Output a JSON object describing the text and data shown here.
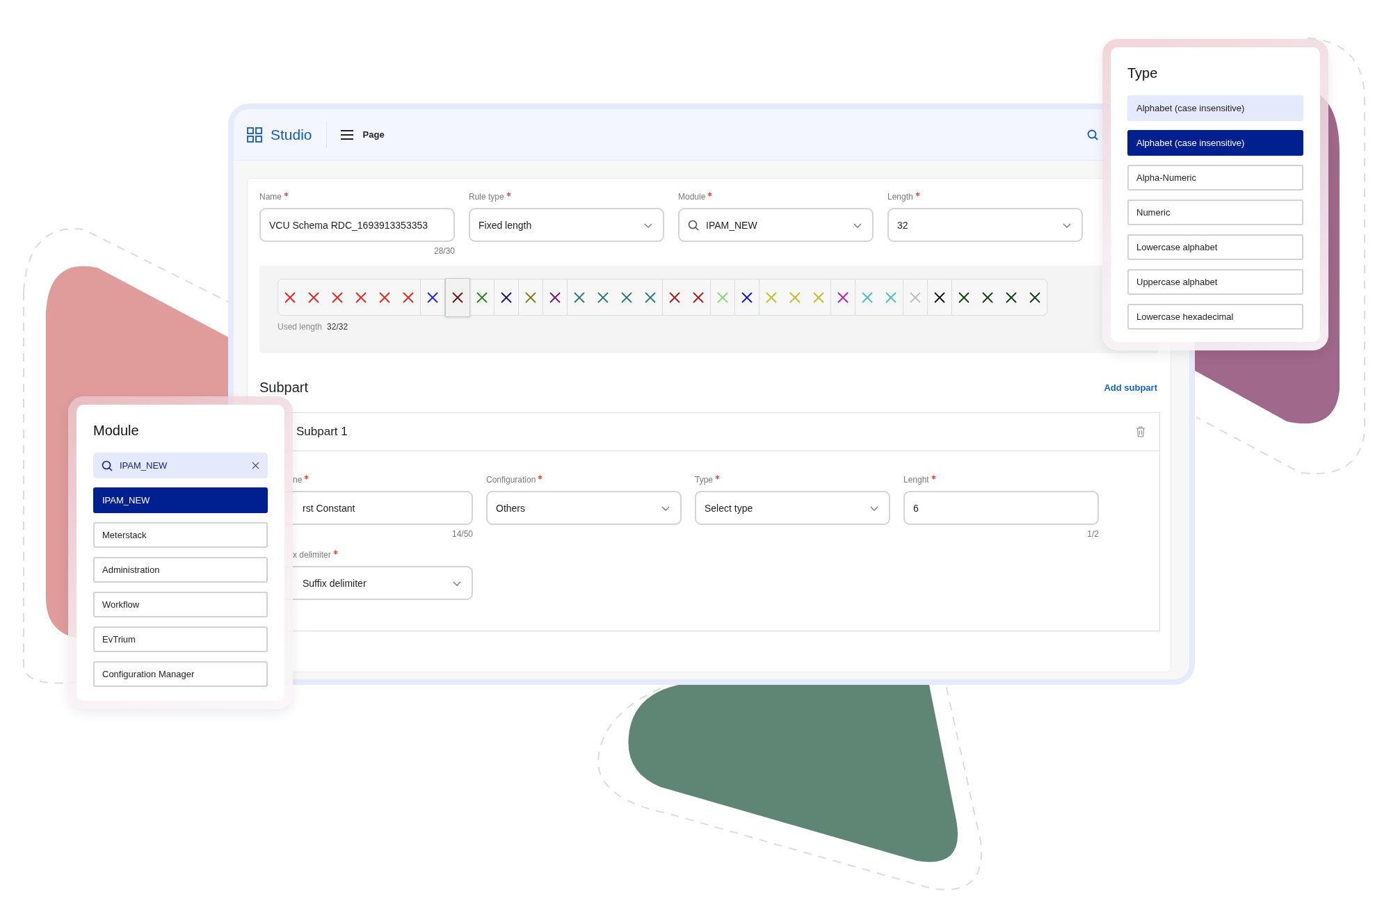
{
  "header": {
    "app_name": "Studio",
    "page_label": "Page"
  },
  "rule_fields": [
    {
      "label": "Name",
      "required": true,
      "kind": "text",
      "value": "VCU Schema RDC_1693913353353",
      "counter": "28/30"
    },
    {
      "label": "Rule type",
      "required": true,
      "kind": "select",
      "value": "Fixed length"
    },
    {
      "label": "Module",
      "required": true,
      "kind": "search-select",
      "value": "IPAM_NEW"
    },
    {
      "label": "Length",
      "required": true,
      "kind": "select",
      "value": "32"
    }
  ],
  "char_strip": {
    "used_label": "Used length",
    "used_value": "32/32",
    "groups": [
      {
        "selected": false,
        "marks": [
          {
            "color": "#e8231f"
          },
          {
            "color": "#e8231f"
          },
          {
            "color": "#e8231f"
          },
          {
            "color": "#e8231f"
          },
          {
            "color": "#e8231f"
          },
          {
            "color": "#e8231f"
          }
        ]
      },
      {
        "selected": false,
        "marks": [
          {
            "color": "#1f1fff"
          }
        ]
      },
      {
        "selected": true,
        "marks": [
          {
            "color": "#6b1010"
          }
        ]
      },
      {
        "selected": false,
        "marks": [
          {
            "color": "#2f7d1f"
          }
        ]
      },
      {
        "selected": false,
        "marks": [
          {
            "color": "#14147f"
          }
        ]
      },
      {
        "selected": false,
        "marks": [
          {
            "color": "#7b7b16"
          }
        ]
      },
      {
        "selected": false,
        "marks": [
          {
            "color": "#6c1b7b"
          }
        ]
      },
      {
        "selected": false,
        "marks": [
          {
            "color": "#2b7b78"
          },
          {
            "color": "#2b7b78"
          },
          {
            "color": "#2b7b78"
          },
          {
            "color": "#2b7b78"
          }
        ]
      },
      {
        "selected": false,
        "marks": [
          {
            "color": "#a81a1a"
          },
          {
            "color": "#a81a1a"
          }
        ]
      },
      {
        "selected": false,
        "marks": [
          {
            "color": "#8cd870"
          }
        ]
      },
      {
        "selected": false,
        "marks": [
          {
            "color": "#1515c0"
          }
        ]
      },
      {
        "selected": false,
        "marks": [
          {
            "color": "#bfbf25"
          },
          {
            "color": "#bfbf25"
          },
          {
            "color": "#bfbf25"
          }
        ]
      },
      {
        "selected": false,
        "marks": [
          {
            "color": "#b51cb5"
          }
        ]
      },
      {
        "selected": false,
        "marks": [
          {
            "color": "#4bbfbf"
          },
          {
            "color": "#4bbfbf"
          }
        ]
      },
      {
        "selected": false,
        "marks": [
          {
            "color": "#bdbdbd"
          }
        ]
      },
      {
        "selected": false,
        "marks": [
          {
            "color": "#111111"
          }
        ]
      },
      {
        "selected": false,
        "marks": [
          {
            "color": "#143a14"
          },
          {
            "color": "#143a14"
          },
          {
            "color": "#143a14"
          },
          {
            "color": "#143a14"
          }
        ]
      }
    ]
  },
  "subpart": {
    "title": "Subpart",
    "add_link": "Add subpart",
    "cards": [
      {
        "title": "Subpart 1",
        "rows": [
          [
            {
              "label": "ne",
              "required": true,
              "kind": "text",
              "value": "rst Constant",
              "counter": "14/50"
            },
            {
              "label": "Configuration",
              "required": true,
              "kind": "select",
              "value": "Others"
            },
            {
              "label": "Type",
              "required": true,
              "kind": "select",
              "value": "Select type"
            },
            {
              "label": "Lenght",
              "required": true,
              "kind": "text",
              "value": "6",
              "counter": "1/2"
            }
          ],
          [
            {
              "label": "x delimiter",
              "required": true,
              "kind": "select",
              "value": "Suffix delimiter"
            }
          ]
        ]
      }
    ]
  },
  "module_panel": {
    "title": "Module",
    "search": {
      "value": "IPAM_NEW"
    },
    "options": [
      {
        "label": "IPAM_NEW",
        "selected": true
      },
      {
        "label": "Meterstack",
        "selected": false
      },
      {
        "label": "Administration",
        "selected": false
      },
      {
        "label": "Workflow",
        "selected": false
      },
      {
        "label": "EvTrium",
        "selected": false
      },
      {
        "label": "Configuration Manager",
        "selected": false
      }
    ]
  },
  "type_panel": {
    "title": "Type",
    "options": [
      {
        "label": "Alphabet (case insensitive)",
        "selected": false,
        "hovered": true
      },
      {
        "label": "Alphabet (case insensitive)",
        "selected": true,
        "hovered": false
      },
      {
        "label": "Alpha-Numeric",
        "selected": false,
        "hovered": false
      },
      {
        "label": "Numeric",
        "selected": false,
        "hovered": false
      },
      {
        "label": "Lowercase alphabet",
        "selected": false,
        "hovered": false
      },
      {
        "label": "Uppercase alphabet",
        "selected": false,
        "hovered": false
      },
      {
        "label": "Lowercase hexadecimal",
        "selected": false,
        "hovered": false
      }
    ]
  }
}
